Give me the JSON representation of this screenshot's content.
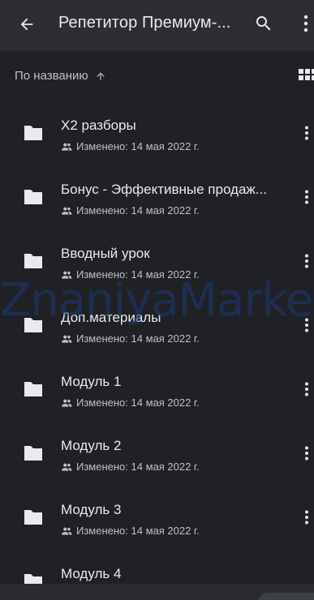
{
  "header": {
    "title": "Репетитор Премиум-...",
    "back_icon": "arrow-back-icon",
    "search_icon": "search-icon",
    "more_icon": "more-vert-icon"
  },
  "sort": {
    "label": "По названию",
    "direction_icon": "arrow-up-icon",
    "view_icon": "grid-view-icon"
  },
  "watermark": "ZnaniyaMarket",
  "files": [
    {
      "name": "X2 разборы",
      "modified": "Изменено: 14 мая 2022 г."
    },
    {
      "name": "Бонус - Эффективные продаж...",
      "modified": "Изменено: 14 мая 2022 г."
    },
    {
      "name": "Вводный урок",
      "modified": "Изменено: 14 мая 2022 г."
    },
    {
      "name": "Доп.материалы",
      "modified": "Изменено: 14 мая 2022 г."
    },
    {
      "name": "Модуль 1",
      "modified": "Изменено: 14 мая 2022 г."
    },
    {
      "name": "Модуль 2",
      "modified": "Изменено: 14 мая 2022 г."
    },
    {
      "name": "Модуль 3",
      "modified": "Изменено: 14 мая 2022 г."
    },
    {
      "name": "Модуль 4",
      "modified": ""
    }
  ],
  "colors": {
    "background": "#202124",
    "header": "#2d2e31",
    "text_primary": "#e8eaed",
    "text_secondary": "#bdc1c6"
  }
}
